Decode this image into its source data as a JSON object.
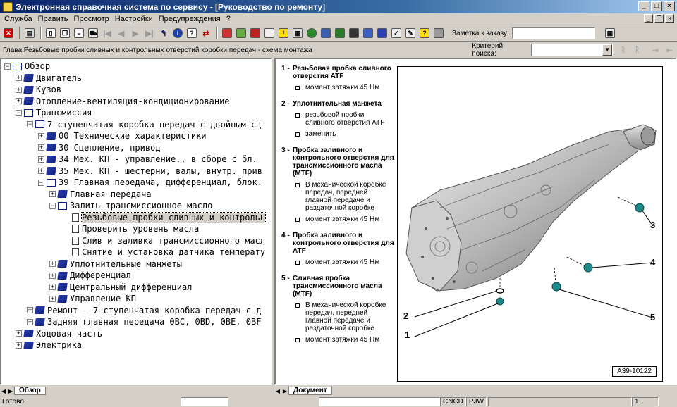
{
  "window": {
    "title": "Электронная справочная система по сервису - [Руководство по ремонту]"
  },
  "menu": [
    "Служба",
    "Править",
    "Просмотр",
    "Настройки",
    "Предупреждения",
    "?"
  ],
  "toolbar": {
    "order_label": "Заметка к заказу:",
    "order_value": ""
  },
  "chapter": {
    "text": "Глава:Резьбовые пробки сливных и контрольных отверстий коробки передач - схема монтажа",
    "criteria_label": "Критерий поиска:",
    "criteria_value": ""
  },
  "tree": [
    {
      "label": "Обзор",
      "expander": "−",
      "icon": "open",
      "selected": false
    },
    {
      "label": "Двигатель",
      "expander": "+",
      "icon": "closed",
      "selected": false
    },
    {
      "label": "Кузов",
      "expander": "+",
      "icon": "closed",
      "selected": false
    },
    {
      "label": "Отопление-вентиляция-кондиционирование",
      "expander": "+",
      "icon": "closed",
      "selected": false
    },
    {
      "label": "Трансмиссия",
      "expander": "−",
      "icon": "open",
      "selected": false
    },
    {
      "label": "7-ступенчатая коробка передач с двойным сц",
      "expander": "−",
      "icon": "open",
      "selected": false
    },
    {
      "label": "00 Технические характеристики",
      "expander": "+",
      "icon": "closed",
      "selected": false
    },
    {
      "label": "30 Сцепление, привод",
      "expander": "+",
      "icon": "closed",
      "selected": false
    },
    {
      "label": "34 Мех. КП - управление., в сборе с бл.",
      "expander": "+",
      "icon": "closed",
      "selected": false
    },
    {
      "label": "35 Мех. КП - шестерни, валы, внутр. прив",
      "expander": "+",
      "icon": "closed",
      "selected": false
    },
    {
      "label": "39 Главная передача, дифференциал, блок.",
      "expander": "−",
      "icon": "open",
      "selected": false
    },
    {
      "label": "Главная передача",
      "expander": "+",
      "icon": "closed",
      "selected": false
    },
    {
      "label": "Залить трансмиссионное масло",
      "expander": "−",
      "icon": "open",
      "selected": false
    },
    {
      "label": "Резьбовые пробки сливных и контрольн",
      "expander": "",
      "icon": "doc",
      "selected": true
    },
    {
      "label": "Проверить уровень масла",
      "expander": "",
      "icon": "doc",
      "selected": false
    },
    {
      "label": "Слив и заливка трансмиссионного масл",
      "expander": "",
      "icon": "doc",
      "selected": false
    },
    {
      "label": "Снятие и установка датчика температу",
      "expander": "",
      "icon": "doc",
      "selected": false
    },
    {
      "label": "Уплотнительные манжеты",
      "expander": "+",
      "icon": "closed",
      "selected": false
    },
    {
      "label": "Дифференциал",
      "expander": "+",
      "icon": "closed",
      "selected": false
    },
    {
      "label": "Центральный дифференциал",
      "expander": "+",
      "icon": "closed",
      "selected": false
    },
    {
      "label": "Управление КП",
      "expander": "+",
      "icon": "closed",
      "selected": false
    },
    {
      "label": "Ремонт - 7-ступенчатая коробка передач с д",
      "expander": "+",
      "icon": "closed",
      "selected": false
    },
    {
      "label": "Задняя главная передача 0BC, 0BD, 0BE, 0BF",
      "expander": "+",
      "icon": "closed",
      "selected": false
    },
    {
      "label": "Ходовая часть",
      "expander": "+",
      "icon": "closed",
      "selected": false
    },
    {
      "label": "Электрика",
      "expander": "+",
      "icon": "closed",
      "selected": false
    }
  ],
  "legend": [
    {
      "num": "1 -",
      "title": "Резьбовая пробка сливного отверстия ATF",
      "bullets": [
        "момент затяжки 45 Нм"
      ]
    },
    {
      "num": "2 -",
      "title": "Уплотнительная манжета",
      "bullets": [
        "резьбовой пробки сливного отверстия ATF",
        "заменить"
      ]
    },
    {
      "num": "3 -",
      "title": "Пробка заливного и контрольного отверстия для трансмиссионного масла (MTF)",
      "bullets": [
        "В механической коробке передач, передней главной передаче и раздаточной коробке",
        "момент затяжки 45 Нм"
      ]
    },
    {
      "num": "4 -",
      "title": "Пробка заливного и контрольного отверстия для ATF",
      "bullets": [
        "момент затяжки 45 Нм"
      ]
    },
    {
      "num": "5 -",
      "title": "Сливная пробка трансмиссионного масла (MTF)",
      "bullets": [
        "В механической коробке передач, передней главной передаче и раздаточной коробке",
        "момент затяжки 45 Нм"
      ]
    }
  ],
  "figure": {
    "labels": [
      "1",
      "2",
      "3",
      "4",
      "5"
    ],
    "ref": "A39-10122"
  },
  "tabs": {
    "left": "Обзор",
    "right": "Документ"
  },
  "status": {
    "text": "Готово",
    "cell1": "CNCD",
    "cell2": "PJW",
    "page": "1"
  }
}
